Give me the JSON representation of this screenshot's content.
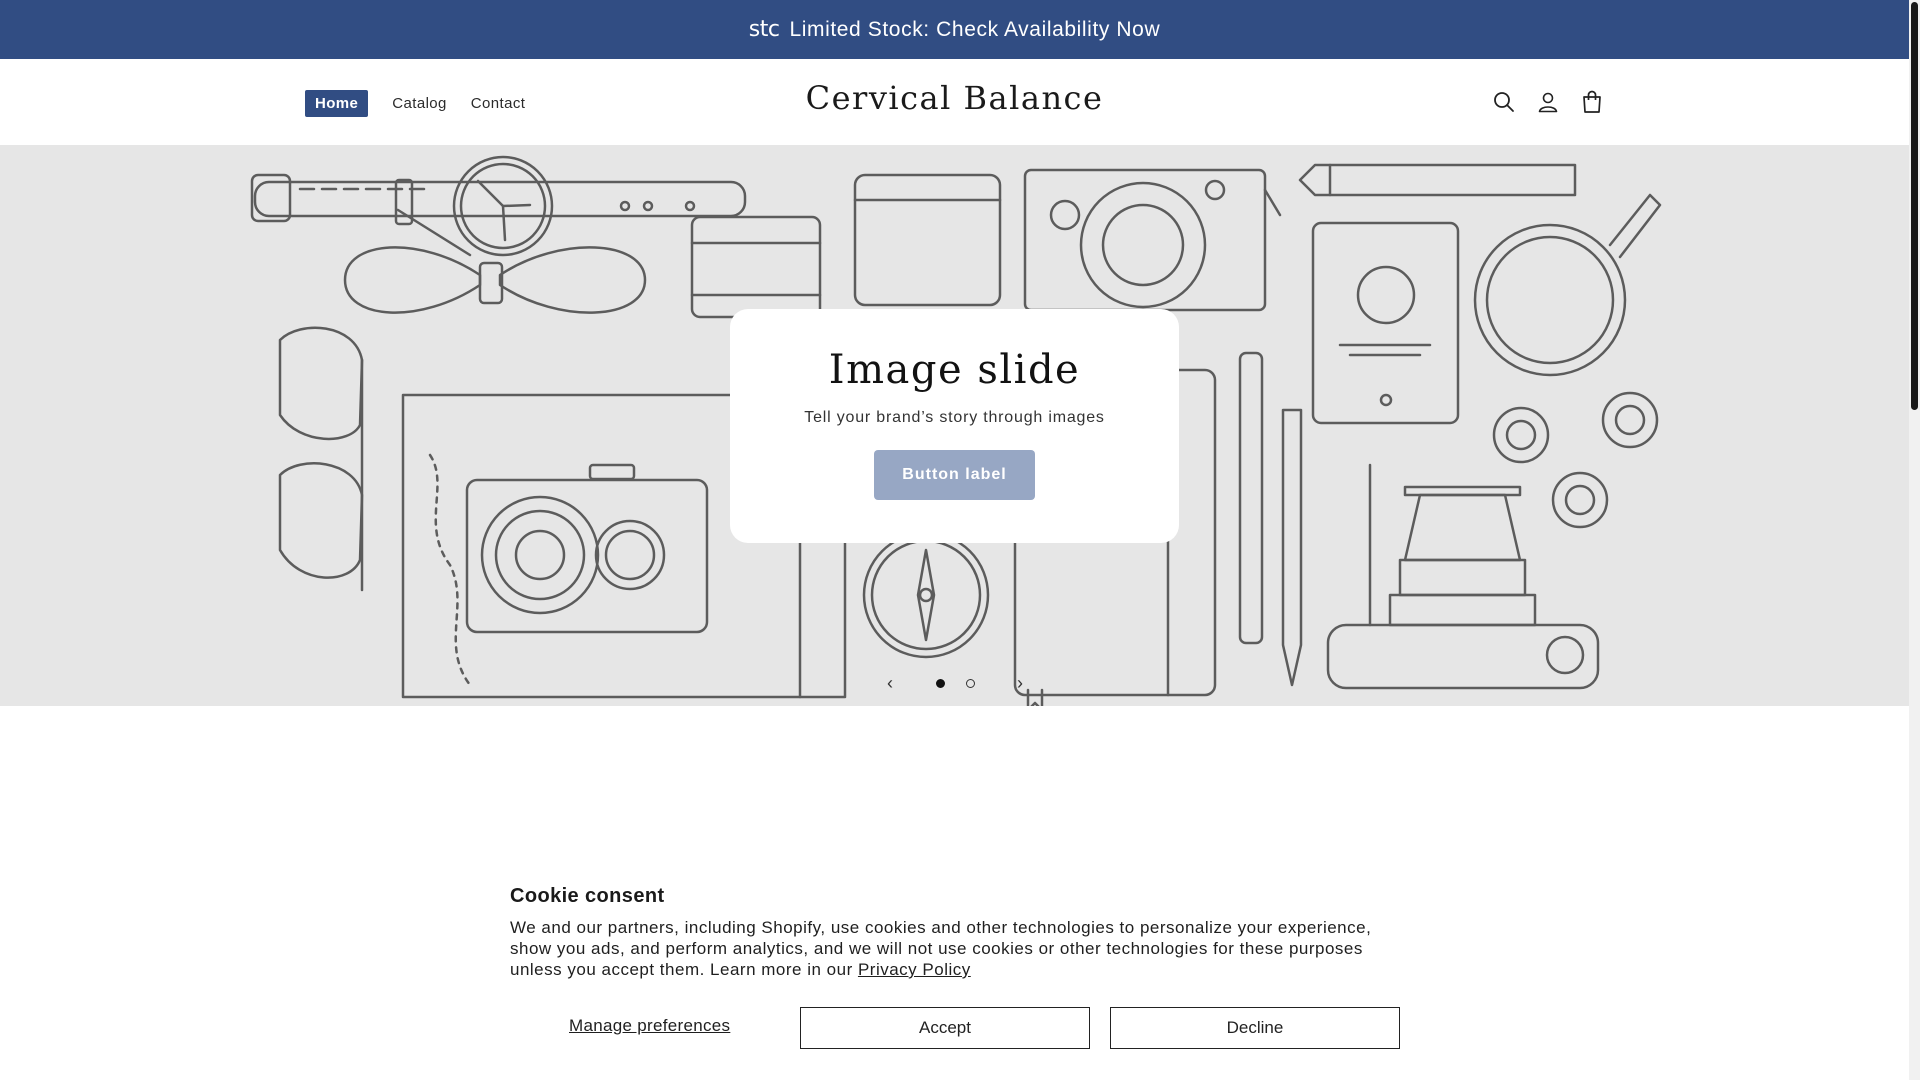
{
  "announcement": {
    "brand_mark": "stc",
    "text": "Limited Stock: Check Availability Now"
  },
  "header": {
    "nav": [
      {
        "label": "Home",
        "active": true
      },
      {
        "label": "Catalog",
        "active": false
      },
      {
        "label": "Contact",
        "active": false
      }
    ],
    "logo": "Cervical Balance",
    "icons": [
      "search-icon",
      "account-icon",
      "cart-icon"
    ]
  },
  "hero": {
    "title": "Image slide",
    "subtitle": "Tell your brand’s story through images",
    "button_label": "Button label",
    "slide_count": 2,
    "current_slide": 1
  },
  "cookie": {
    "title": "Cookie consent",
    "text": "We and our partners, including Shopify, use cookies and other technologies to personalize your experience, show you ads, and perform analytics, and we will not use cookies or other technologies for these purposes unless you accept them. Learn more in our ",
    "policy_link": "Privacy Policy",
    "manage_label": "Manage preferences",
    "accept_label": "Accept",
    "decline_label": "Decline"
  },
  "colors": {
    "brand": "#314d83",
    "hero_background": "#e6e6e6",
    "button_disabled": "#97a7c4"
  }
}
